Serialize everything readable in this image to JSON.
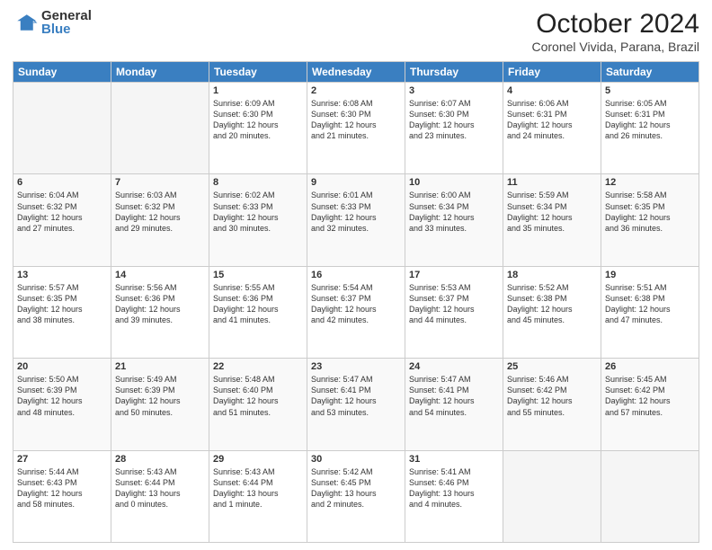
{
  "header": {
    "logo_general": "General",
    "logo_blue": "Blue",
    "month_title": "October 2024",
    "subtitle": "Coronel Vivida, Parana, Brazil"
  },
  "weekdays": [
    "Sunday",
    "Monday",
    "Tuesday",
    "Wednesday",
    "Thursday",
    "Friday",
    "Saturday"
  ],
  "weeks": [
    [
      {
        "day": "",
        "empty": true
      },
      {
        "day": "",
        "empty": true
      },
      {
        "day": "1",
        "sunrise": "6:09 AM",
        "sunset": "6:30 PM",
        "daylight": "12 hours and 20 minutes."
      },
      {
        "day": "2",
        "sunrise": "6:08 AM",
        "sunset": "6:30 PM",
        "daylight": "12 hours and 21 minutes."
      },
      {
        "day": "3",
        "sunrise": "6:07 AM",
        "sunset": "6:30 PM",
        "daylight": "12 hours and 23 minutes."
      },
      {
        "day": "4",
        "sunrise": "6:06 AM",
        "sunset": "6:31 PM",
        "daylight": "12 hours and 24 minutes."
      },
      {
        "day": "5",
        "sunrise": "6:05 AM",
        "sunset": "6:31 PM",
        "daylight": "12 hours and 26 minutes."
      }
    ],
    [
      {
        "day": "6",
        "sunrise": "6:04 AM",
        "sunset": "6:32 PM",
        "daylight": "12 hours and 27 minutes."
      },
      {
        "day": "7",
        "sunrise": "6:03 AM",
        "sunset": "6:32 PM",
        "daylight": "12 hours and 29 minutes."
      },
      {
        "day": "8",
        "sunrise": "6:02 AM",
        "sunset": "6:33 PM",
        "daylight": "12 hours and 30 minutes."
      },
      {
        "day": "9",
        "sunrise": "6:01 AM",
        "sunset": "6:33 PM",
        "daylight": "12 hours and 32 minutes."
      },
      {
        "day": "10",
        "sunrise": "6:00 AM",
        "sunset": "6:34 PM",
        "daylight": "12 hours and 33 minutes."
      },
      {
        "day": "11",
        "sunrise": "5:59 AM",
        "sunset": "6:34 PM",
        "daylight": "12 hours and 35 minutes."
      },
      {
        "day": "12",
        "sunrise": "5:58 AM",
        "sunset": "6:35 PM",
        "daylight": "12 hours and 36 minutes."
      }
    ],
    [
      {
        "day": "13",
        "sunrise": "5:57 AM",
        "sunset": "6:35 PM",
        "daylight": "12 hours and 38 minutes."
      },
      {
        "day": "14",
        "sunrise": "5:56 AM",
        "sunset": "6:36 PM",
        "daylight": "12 hours and 39 minutes."
      },
      {
        "day": "15",
        "sunrise": "5:55 AM",
        "sunset": "6:36 PM",
        "daylight": "12 hours and 41 minutes."
      },
      {
        "day": "16",
        "sunrise": "5:54 AM",
        "sunset": "6:37 PM",
        "daylight": "12 hours and 42 minutes."
      },
      {
        "day": "17",
        "sunrise": "5:53 AM",
        "sunset": "6:37 PM",
        "daylight": "12 hours and 44 minutes."
      },
      {
        "day": "18",
        "sunrise": "5:52 AM",
        "sunset": "6:38 PM",
        "daylight": "12 hours and 45 minutes."
      },
      {
        "day": "19",
        "sunrise": "5:51 AM",
        "sunset": "6:38 PM",
        "daylight": "12 hours and 47 minutes."
      }
    ],
    [
      {
        "day": "20",
        "sunrise": "5:50 AM",
        "sunset": "6:39 PM",
        "daylight": "12 hours and 48 minutes."
      },
      {
        "day": "21",
        "sunrise": "5:49 AM",
        "sunset": "6:39 PM",
        "daylight": "12 hours and 50 minutes."
      },
      {
        "day": "22",
        "sunrise": "5:48 AM",
        "sunset": "6:40 PM",
        "daylight": "12 hours and 51 minutes."
      },
      {
        "day": "23",
        "sunrise": "5:47 AM",
        "sunset": "6:41 PM",
        "daylight": "12 hours and 53 minutes."
      },
      {
        "day": "24",
        "sunrise": "5:47 AM",
        "sunset": "6:41 PM",
        "daylight": "12 hours and 54 minutes."
      },
      {
        "day": "25",
        "sunrise": "5:46 AM",
        "sunset": "6:42 PM",
        "daylight": "12 hours and 55 minutes."
      },
      {
        "day": "26",
        "sunrise": "5:45 AM",
        "sunset": "6:42 PM",
        "daylight": "12 hours and 57 minutes."
      }
    ],
    [
      {
        "day": "27",
        "sunrise": "5:44 AM",
        "sunset": "6:43 PM",
        "daylight": "12 hours and 58 minutes."
      },
      {
        "day": "28",
        "sunrise": "5:43 AM",
        "sunset": "6:44 PM",
        "daylight": "13 hours and 0 minutes."
      },
      {
        "day": "29",
        "sunrise": "5:43 AM",
        "sunset": "6:44 PM",
        "daylight": "13 hours and 1 minute."
      },
      {
        "day": "30",
        "sunrise": "5:42 AM",
        "sunset": "6:45 PM",
        "daylight": "13 hours and 2 minutes."
      },
      {
        "day": "31",
        "sunrise": "5:41 AM",
        "sunset": "6:46 PM",
        "daylight": "13 hours and 4 minutes."
      },
      {
        "day": "",
        "empty": true
      },
      {
        "day": "",
        "empty": true
      }
    ]
  ],
  "labels": {
    "sunrise": "Sunrise:",
    "sunset": "Sunset:",
    "daylight": "Daylight:"
  }
}
